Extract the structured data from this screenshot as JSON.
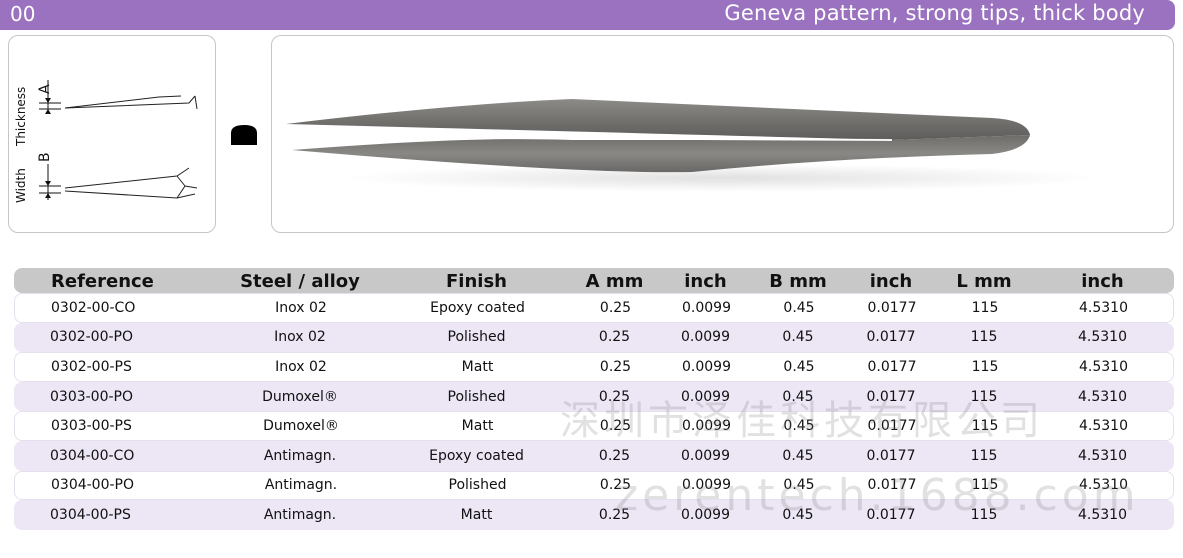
{
  "header": {
    "model_code": "00",
    "title": "Geneva pattern, strong tips, thick body"
  },
  "diagram": {
    "thickness_label": "Thickness",
    "thickness_letter": "A",
    "width_label": "Width",
    "width_letter": "B"
  },
  "table": {
    "headers": [
      "Reference",
      "Steel / alloy",
      "Finish",
      "A mm",
      "inch",
      "B mm",
      "inch",
      "L mm",
      "inch"
    ],
    "rows": [
      [
        "0302-00-CO",
        "Inox 02",
        "Epoxy coated",
        "0.25",
        "0.0099",
        "0.45",
        "0.0177",
        "115",
        "4.5310"
      ],
      [
        "0302-00-PO",
        "Inox 02",
        "Polished",
        "0.25",
        "0.0099",
        "0.45",
        "0.0177",
        "115",
        "4.5310"
      ],
      [
        "0302-00-PS",
        "Inox 02",
        "Matt",
        "0.25",
        "0.0099",
        "0.45",
        "0.0177",
        "115",
        "4.5310"
      ],
      [
        "0303-00-PO",
        "Dumoxel®",
        "Polished",
        "0.25",
        "0.0099",
        "0.45",
        "0.0177",
        "115",
        "4.5310"
      ],
      [
        "0303-00-PS",
        "Dumoxel®",
        "Matt",
        "0.25",
        "0.0099",
        "0.45",
        "0.0177",
        "115",
        "4.5310"
      ],
      [
        "0304-00-CO",
        "Antimagn.",
        "Epoxy coated",
        "0.25",
        "0.0099",
        "0.45",
        "0.0177",
        "115",
        "4.5310"
      ],
      [
        "0304-00-PO",
        "Antimagn.",
        "Polished",
        "0.25",
        "0.0099",
        "0.45",
        "0.0177",
        "115",
        "4.5310"
      ],
      [
        "0304-00-PS",
        "Antimagn.",
        "Matt",
        "0.25",
        "0.0099",
        "0.45",
        "0.0177",
        "115",
        "4.5310"
      ]
    ]
  },
  "watermark": {
    "line1": "深圳市泽佳科技有限公司",
    "line2": "zerentech.1688.com"
  },
  "colors": {
    "header_bg": "#9a72bf",
    "header_text": "#ffffff",
    "table_header_bg": "#c8c8c8",
    "row_alt_bg": "#ece6f5"
  }
}
